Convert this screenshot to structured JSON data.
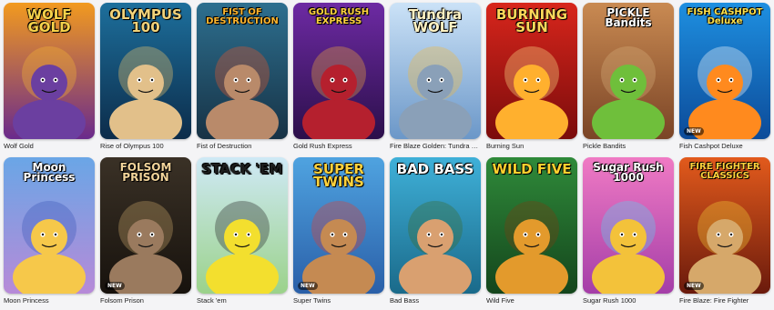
{
  "games": [
    {
      "name": "Wolf Gold",
      "logo": "WOLF GOLD",
      "logo_color": "#f6d24a",
      "badge": "",
      "bg_top": "#f29a1f",
      "bg_bottom": "#6a2a8c",
      "figure": "#6b3fa0",
      "accent": "#f7b733"
    },
    {
      "name": "Rise of Olympus 100",
      "logo": "OLYMPUS 100",
      "logo_color": "#f1d27a",
      "badge": "",
      "bg_top": "#1d6f9c",
      "bg_bottom": "#0c2c4a",
      "figure": "#e2c08a",
      "accent": "#f3c969"
    },
    {
      "name": "Fist of Destruction",
      "logo": "FIST OF DESTRUCTION",
      "logo_color": "#ffb62e",
      "badge": "",
      "bg_top": "#2d6f8f",
      "bg_bottom": "#173245",
      "figure": "#b98a6a",
      "accent": "#e8562a"
    },
    {
      "name": "Gold Rush Express",
      "logo": "GOLD RUSH EXPRESS",
      "logo_color": "#ffd23f",
      "badge": "",
      "bg_top": "#6d2aa3",
      "bg_bottom": "#2b0f4a",
      "figure": "#b5202e",
      "accent": "#f2a93b"
    },
    {
      "name": "Fire Blaze Golden: Tundra Wolf",
      "logo": "Tundra WOLF",
      "logo_color": "#fff3c4",
      "badge": "",
      "bg_top": "#cbe2f7",
      "bg_bottom": "#6b97c8",
      "figure": "#8aa0b8",
      "accent": "#f3b63a"
    },
    {
      "name": "Burning Sun",
      "logo": "BURNING SUN",
      "logo_color": "#ffd85a",
      "badge": "",
      "bg_top": "#d8261c",
      "bg_bottom": "#7a0b0b",
      "figure": "#ffb02e",
      "accent": "#ffe28a"
    },
    {
      "name": "Pickle Bandits",
      "logo": "PICKLE Bandits",
      "logo_color": "#ffffff",
      "badge": "",
      "bg_top": "#c98a52",
      "bg_bottom": "#7a4426",
      "figure": "#6fbf3b",
      "accent": "#d6b07a"
    },
    {
      "name": "Fish Cashpot Deluxe",
      "logo": "FISH CASHPOT Deluxe",
      "logo_color": "#ffe14a",
      "badge": "NEW",
      "bg_top": "#1e8fe0",
      "bg_bottom": "#0c4b99",
      "figure": "#ff8a1e",
      "accent": "#ffffff"
    },
    {
      "name": "Moon Princess",
      "logo": "Moon Princess",
      "logo_color": "#ffffff",
      "badge": "",
      "bg_top": "#6aa6e6",
      "bg_bottom": "#b78ad8",
      "figure": "#f6c84a",
      "accent": "#3a57b8"
    },
    {
      "name": "Folsom Prison",
      "logo": "FOLSOM PRISON",
      "logo_color": "#f2d49a",
      "badge": "NEW",
      "bg_top": "#3a3126",
      "bg_bottom": "#17120d",
      "figure": "#9a7a5e",
      "accent": "#c9a56a"
    },
    {
      "name": "Stack 'em",
      "logo": "STACK 'EM",
      "logo_color": "#1d1d1d",
      "badge": "",
      "bg_top": "#cfe9f6",
      "bg_bottom": "#9bd28a",
      "figure": "#f3df2e",
      "accent": "#222222"
    },
    {
      "name": "Super Twins",
      "logo": "SUPER TWINS",
      "logo_color": "#ffd23c",
      "badge": "NEW",
      "bg_top": "#4fa3e0",
      "bg_bottom": "#2a5fa8",
      "figure": "#c58a52",
      "accent": "#e23b2e"
    },
    {
      "name": "Bad Bass",
      "logo": "BAD BASS",
      "logo_color": "#ffffff",
      "badge": "",
      "bg_top": "#3fb0d8",
      "bg_bottom": "#1a6a8a",
      "figure": "#d9a070",
      "accent": "#3b6b2a"
    },
    {
      "name": "Wild Five",
      "logo": "WILD FIVE",
      "logo_color": "#ffd02e",
      "badge": "",
      "bg_top": "#2f8a3a",
      "bg_bottom": "#14451c",
      "figure": "#e39a2c",
      "accent": "#7a3b12"
    },
    {
      "name": "Sugar Rush 1000",
      "logo": "Sugar Rush 1000",
      "logo_color": "#ffffff",
      "badge": "",
      "bg_top": "#f07ac4",
      "bg_bottom": "#a43ea8",
      "figure": "#f3c23a",
      "accent": "#5ad0f0"
    },
    {
      "name": "Fire Blaze: Fire Fighter",
      "logo": "FIRE FIGHTER CLASSICS",
      "logo_color": "#ffd23c",
      "badge": "NEW",
      "bg_top": "#e25a1c",
      "bg_bottom": "#6a1a0c",
      "figure": "#d6a86a",
      "accent": "#f3d23a"
    }
  ]
}
